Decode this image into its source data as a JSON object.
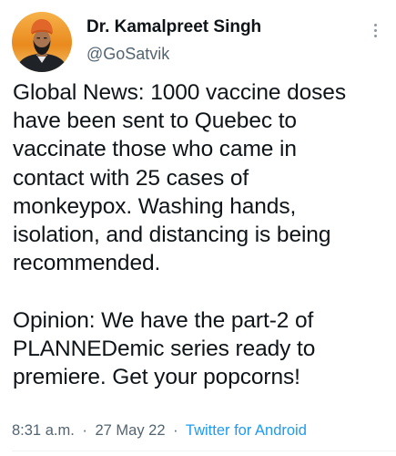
{
  "author": {
    "display_name": "Dr. Kamalpreet Singh",
    "handle": "@GoSatvik"
  },
  "tweet": {
    "paragraph_1_lines": [
      "Global News: 1000 vaccine doses",
      "have been sent to Quebec to",
      "vaccinate those who came in",
      "contact with 25 cases of",
      "monkeypox. Washing hands,",
      "isolation, and distancing is being",
      "recommended."
    ],
    "paragraph_2_lines": [
      "Opinion: We have the part-2 of",
      "PLANNEDemic series ready to",
      "premiere. Get your popcorns!"
    ]
  },
  "meta": {
    "time": "8:31 a.m.",
    "separator": "·",
    "date": "27 May 22",
    "source": "Twitter for Android"
  },
  "icons": {
    "more": "more-vertical-icon"
  },
  "colors": {
    "text_primary": "#0f1419",
    "text_secondary": "#536471",
    "link": "#1d9bf0",
    "avatar_background": "#f0a236",
    "turban": "#e0662a"
  }
}
